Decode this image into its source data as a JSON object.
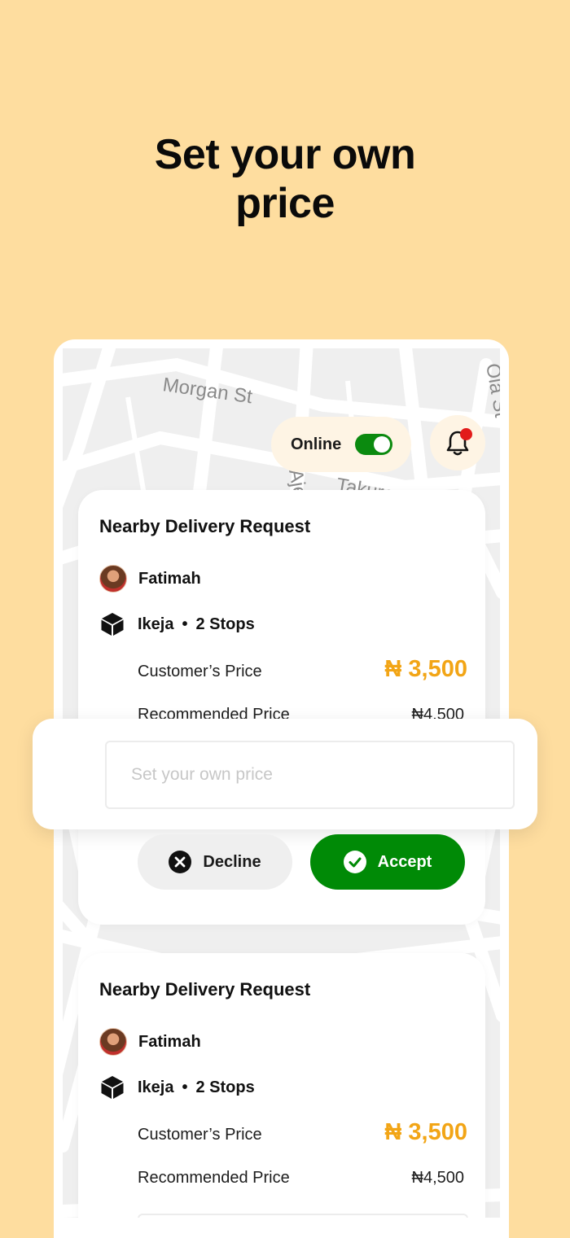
{
  "headline": {
    "line1": "Set your own",
    "line2": "price"
  },
  "map": {
    "street_labels": [
      "Morgan St",
      "Takuro",
      "Ola St",
      "Aje St"
    ]
  },
  "status": {
    "label": "Online",
    "toggle_on": true
  },
  "notification": {
    "has_unread": true
  },
  "requests": [
    {
      "title": "Nearby Delivery Request",
      "customer": "Fatimah",
      "location": "Ikeja",
      "separator": "•",
      "stops": "2 Stops",
      "customer_price_label": "Customer’s Price",
      "customer_price": "₦ 3,500",
      "recommended_price_label": "Recommended Price",
      "recommended_price": "₦4,500"
    },
    {
      "title": "Nearby Delivery Request",
      "customer": "Fatimah",
      "location": "Ikeja",
      "separator": "•",
      "stops": "2 Stops",
      "customer_price_label": "Customer’s Price",
      "customer_price": "₦ 3,500",
      "recommended_price_label": "Recommended Price",
      "recommended_price": "₦4,500"
    }
  ],
  "price_input": {
    "placeholder": "Set your own price",
    "value": ""
  },
  "actions": {
    "decline_label": "Decline",
    "accept_label": "Accept"
  },
  "colors": {
    "background": "#FEDD9F",
    "accent_price": "#F2A516",
    "accept": "#008A06",
    "toggle_on": "#0B8A0F",
    "notification_dot": "#E21B1B"
  }
}
